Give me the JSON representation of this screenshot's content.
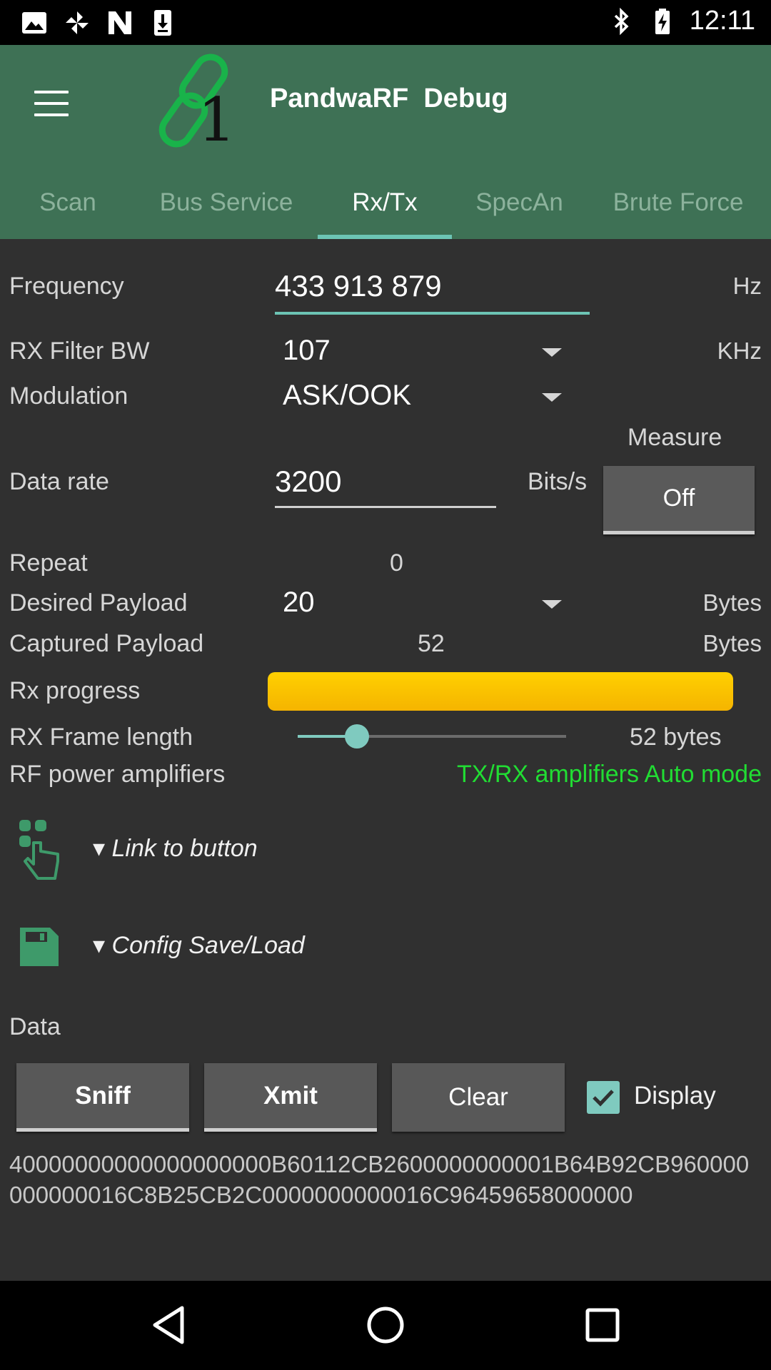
{
  "status_bar": {
    "time": "12:11",
    "left_icons": [
      "image-icon",
      "pinwheel-icon",
      "n-logo-icon",
      "download-icon"
    ],
    "right_icons": [
      "bluetooth-icon",
      "battery-charging-icon"
    ]
  },
  "app_bar": {
    "title": "PandwaRF  Debug",
    "logo_text": "1"
  },
  "tabs": [
    {
      "label": "Scan",
      "active": false
    },
    {
      "label": "Bus Service",
      "active": false
    },
    {
      "label": "Rx/Tx",
      "active": true
    },
    {
      "label": "SpecAn",
      "active": false
    },
    {
      "label": "Brute Force",
      "active": false
    }
  ],
  "frequency": {
    "label": "Frequency",
    "value": "433 913 879",
    "unit": "Hz"
  },
  "rx_filter_bw": {
    "label": "RX Filter BW",
    "value": "107",
    "unit": "KHz"
  },
  "modulation": {
    "label": "Modulation",
    "value": "ASK/OOK"
  },
  "data_rate": {
    "label": "Data rate",
    "value": "3200",
    "unit": "Bits/s"
  },
  "measure": {
    "label": "Measure",
    "button": "Off"
  },
  "repeat": {
    "label": "Repeat",
    "value": "0"
  },
  "desired_payload": {
    "label": "Desired Payload",
    "value": "20",
    "unit": "Bytes"
  },
  "captured_payload": {
    "label": "Captured Payload",
    "value": "52",
    "unit": "Bytes"
  },
  "rx_progress": {
    "label": "Rx progress",
    "fraction": 1.0
  },
  "rx_frame_length": {
    "label": "RX Frame length",
    "value_text": "52 bytes",
    "slider_fraction": 0.22
  },
  "rf_power": {
    "label": "RF power amplifiers",
    "status": "TX/RX amplifiers Auto mode",
    "status_color": "#21dd33"
  },
  "sections": {
    "link_to_button": "▾ Link to button",
    "config_save_load": "▾ Config Save/Load"
  },
  "data_section": {
    "label": "Data",
    "sniff": "Sniff",
    "xmit": "Xmit",
    "clear": "Clear",
    "display_label": "Display",
    "display_checked": true,
    "dump": "40000000000000000000B60112CB2600000000001B64B92CB960000000000016C8B25CB2C0000000000016C96459658000000"
  },
  "colors": {
    "app_bar": "#3e7155",
    "accent": "#6cc4b4",
    "progress": "#ffc400",
    "background": "#303030"
  }
}
